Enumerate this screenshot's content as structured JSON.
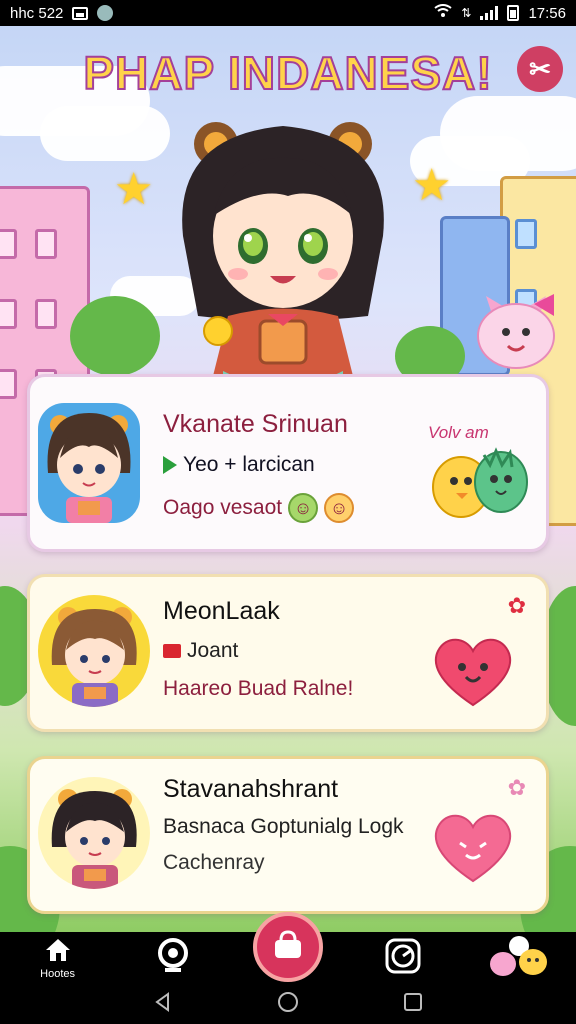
{
  "status_bar": {
    "left_text": "hhc 522",
    "time": "17:56",
    "icons": [
      "image-icon",
      "app-icon",
      "wifi-icon",
      "data-icon",
      "signal-icon",
      "battery-icon"
    ]
  },
  "header": {
    "title": "PHAP INDANESA!",
    "close_icon": "close-icon"
  },
  "cards": [
    {
      "title": "Vkanate Srinuan",
      "line1": "Yeo + larcican",
      "line2": "Oago vesaot",
      "art_text": "Volv am",
      "icon": "play-flag-icon"
    },
    {
      "title": "MeonLaak",
      "line1": "Joant",
      "line2": "Haareo Buad Ralne!",
      "icon": "red-flag-icon",
      "corner_icon": "bow-icon"
    },
    {
      "title": "Stavanahshrant",
      "line1": "Basnaca Goptunialg Logk",
      "line2": "Cachenray",
      "corner_icon": "bow-outline-icon"
    }
  ],
  "bottom_nav": {
    "items": [
      {
        "label": "Hootes",
        "icon": "home-icon"
      },
      {
        "label": "",
        "icon": "webcam-icon"
      },
      {
        "label": "",
        "icon": "shopping-bag-icon"
      },
      {
        "label": "",
        "icon": "clock-icon"
      },
      {
        "label": "",
        "icon": "friends-icon"
      }
    ]
  },
  "colors": {
    "accent": "#d7345c",
    "title_fill": "#ffd34a",
    "title_stroke": "#a3409a",
    "card_title": "#8c1f3e"
  }
}
